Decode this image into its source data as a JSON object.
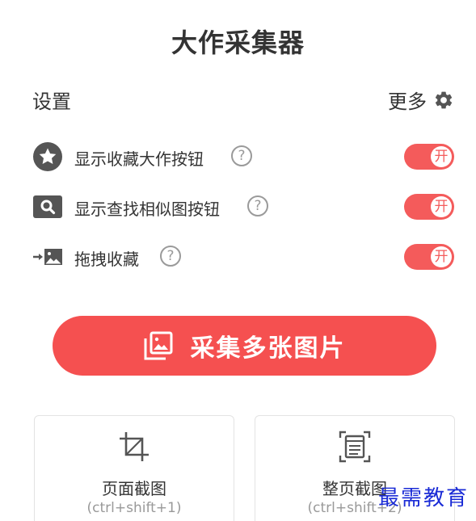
{
  "app": {
    "title": "大作采集器"
  },
  "settings": {
    "label": "设置",
    "more_label": "更多",
    "more_icon": "gear-icon"
  },
  "options": [
    {
      "label": "显示收藏大作按钮",
      "icon": "star-circle-icon",
      "help": "?",
      "state": "开",
      "on": true
    },
    {
      "label": "显示查找相似图按钮",
      "icon": "image-search-icon",
      "help": "?",
      "state": "开",
      "on": true
    },
    {
      "label": "拖拽收藏",
      "icon": "drag-image-icon",
      "help": "?",
      "state": "开",
      "on": true
    }
  ],
  "collect_button": {
    "label": "采集多张图片",
    "icon": "multi-image-icon"
  },
  "capture": [
    {
      "label": "页面截图",
      "shortcut": "(ctrl+shift+1)",
      "icon": "crop-icon"
    },
    {
      "label": "整页截图",
      "shortcut": "(ctrl+shift+2)",
      "icon": "full-page-icon"
    }
  ],
  "watermark": "最需教育",
  "colors": {
    "accent": "#f55050",
    "text": "#333333",
    "muted": "#999999",
    "icon": "#555555",
    "watermark": "#1a2bd6"
  }
}
